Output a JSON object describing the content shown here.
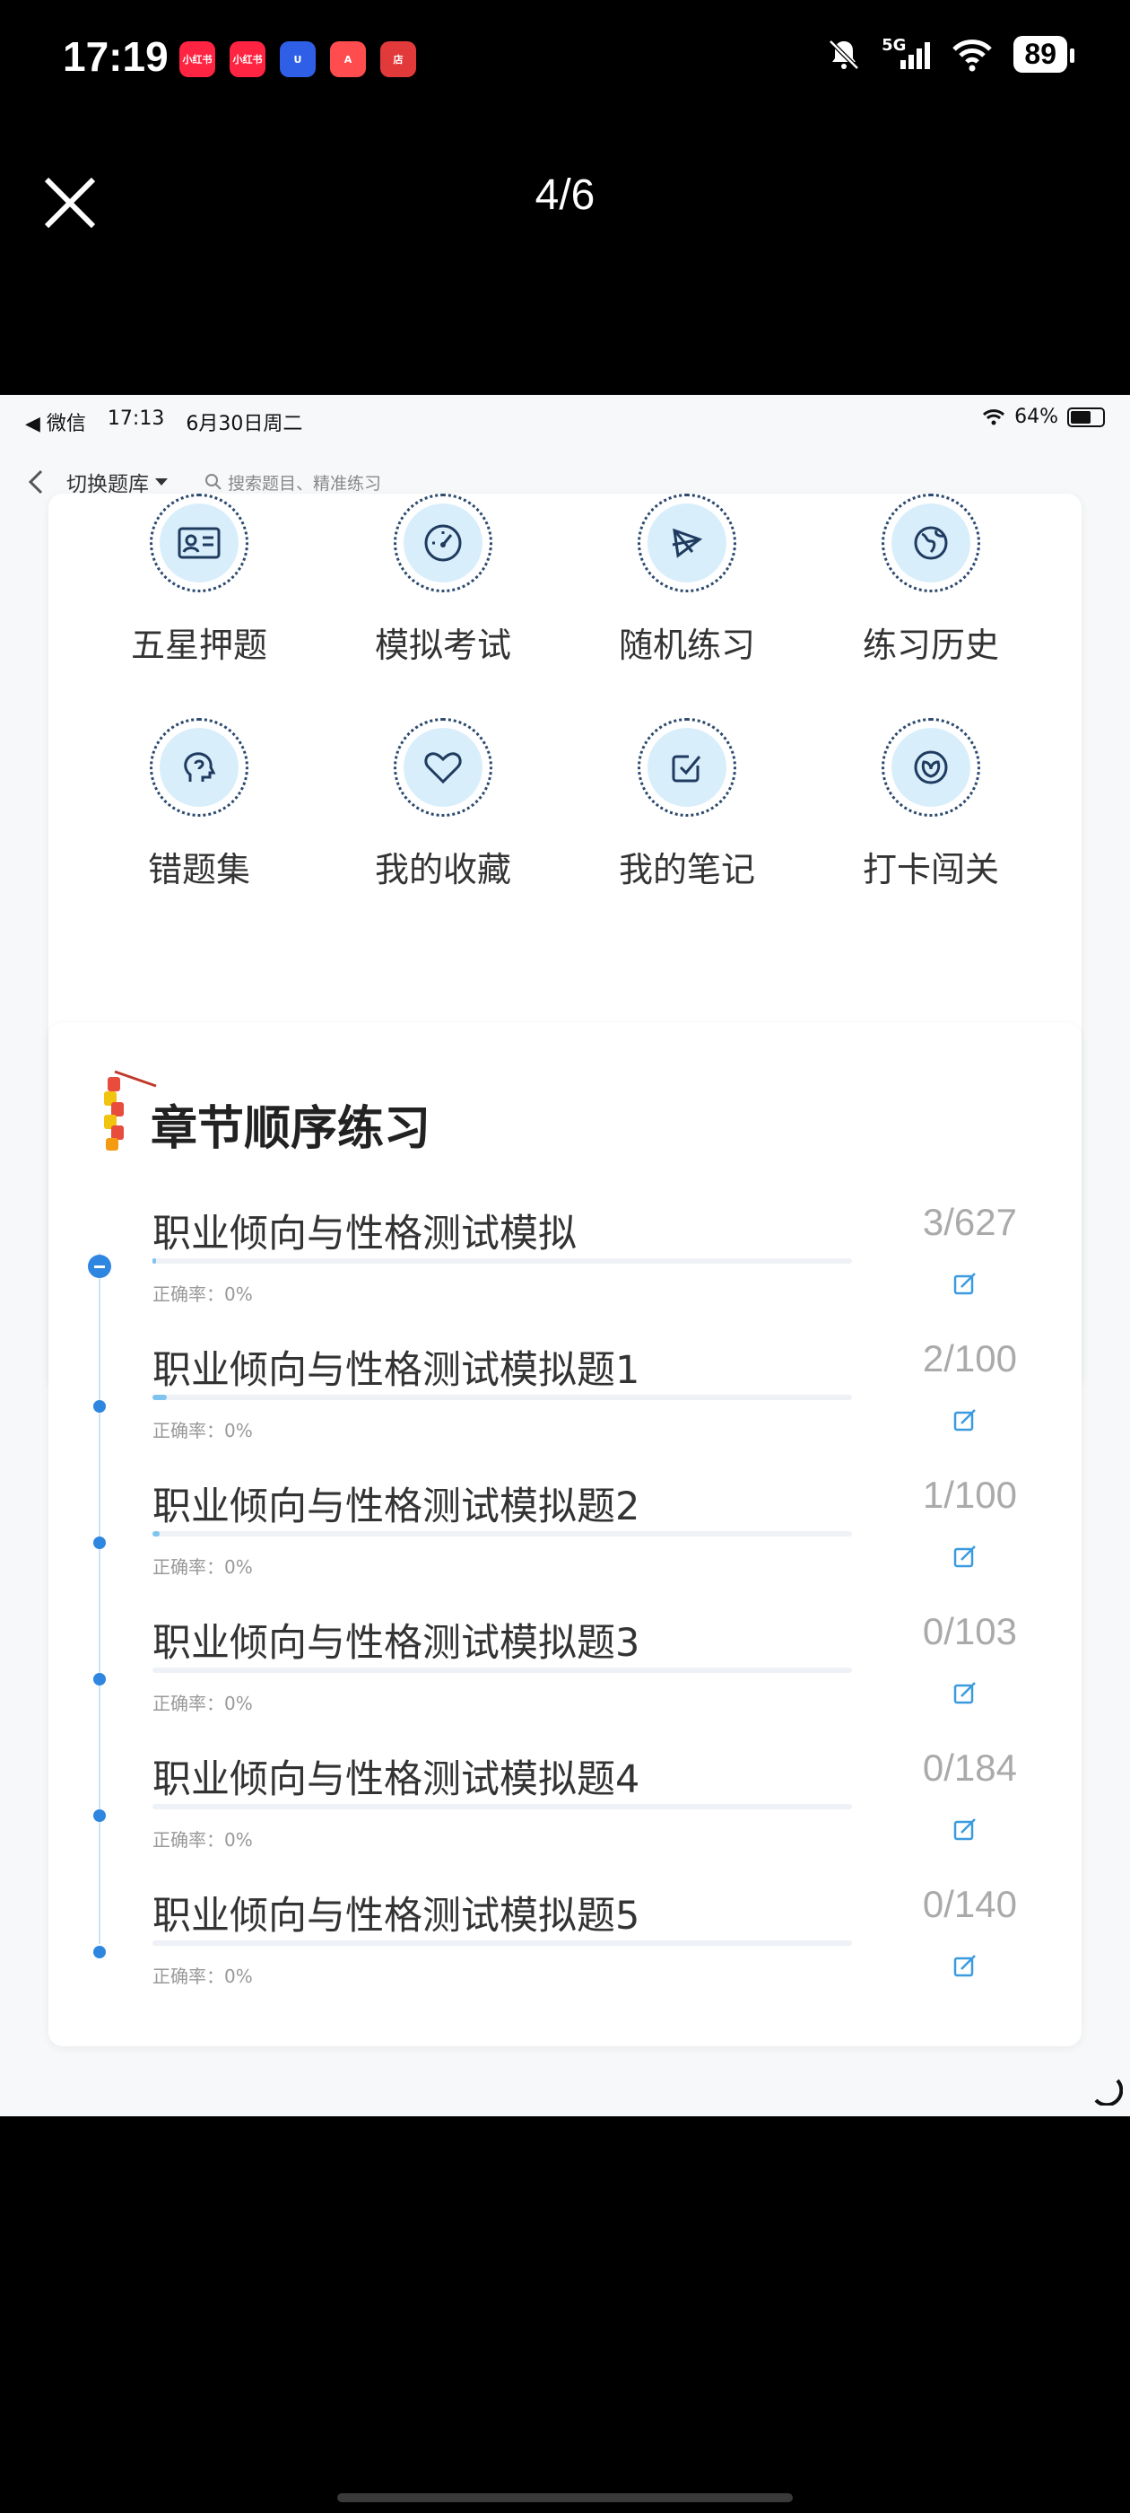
{
  "phone_status": {
    "time": "17:19",
    "apps": [
      {
        "name": "xiaohongshu-app-icon",
        "label": "小红书",
        "color": "#ff2442"
      },
      {
        "name": "xiaohongshu-app-icon-2",
        "label": "小红书",
        "color": "#ff2442"
      },
      {
        "name": "u-app-icon",
        "label": "U",
        "color": "#2f5fe6"
      },
      {
        "name": "a-app-icon",
        "label": "A",
        "color": "#ff4d4f"
      },
      {
        "name": "store-app-icon",
        "label": "店",
        "color": "#e23a3a"
      }
    ],
    "network": "5G",
    "battery": "89"
  },
  "viewer": {
    "page_counter": "4/6"
  },
  "inner_status": {
    "back_app": "◀ 微信",
    "time": "17:13",
    "date": "6月30日周二",
    "battery": "64%"
  },
  "nav": {
    "switch_label": "切换题库",
    "search_placeholder": "搜索题目、精准练习"
  },
  "grid": {
    "items": [
      {
        "label": "五星押题",
        "icon": "id-card-icon"
      },
      {
        "label": "模拟考试",
        "icon": "speedometer-icon"
      },
      {
        "label": "随机练习",
        "icon": "shuffle-icon"
      },
      {
        "label": "练习历史",
        "icon": "globe-icon"
      },
      {
        "label": "错题集",
        "icon": "head-icon"
      },
      {
        "label": "我的收藏",
        "icon": "heart-icon"
      },
      {
        "label": "我的笔记",
        "icon": "note-check-icon"
      },
      {
        "label": "打卡闯关",
        "icon": "leaf-icon"
      }
    ],
    "page_dots": 2,
    "active_dot": 0
  },
  "chapters": {
    "title": "章节顺序练习",
    "items": [
      {
        "name": "职业倾向与性格测试模拟",
        "progress": "3/627",
        "accuracy": "正确率：0%",
        "fraction": 0.005
      },
      {
        "name": "职业倾向与性格测试模拟题1",
        "progress": "2/100",
        "accuracy": "正确率：0%",
        "fraction": 0.02
      },
      {
        "name": "职业倾向与性格测试模拟题2",
        "progress": "1/100",
        "accuracy": "正确率：0%",
        "fraction": 0.01
      },
      {
        "name": "职业倾向与性格测试模拟题3",
        "progress": "0/103",
        "accuracy": "正确率：0%",
        "fraction": 0
      },
      {
        "name": "职业倾向与性格测试模拟题4",
        "progress": "0/184",
        "accuracy": "正确率：0%",
        "fraction": 0
      },
      {
        "name": "职业倾向与性格测试模拟题5",
        "progress": "0/140",
        "accuracy": "正确率：0%",
        "fraction": 0
      }
    ]
  }
}
